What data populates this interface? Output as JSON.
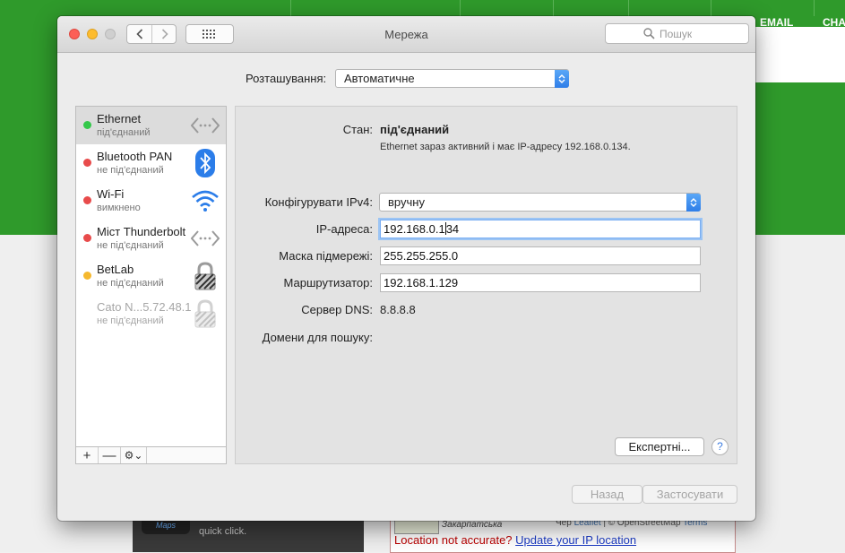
{
  "background": {
    "nav": {
      "email": "EMAIL",
      "chat": "CHA"
    },
    "panel_badge": "Maps",
    "panel_text": "quick click.",
    "map": {
      "region": "Закарпатська",
      "credit_prefix": "Чер",
      "credit_leaflet": "Leaflet",
      "credit_mid": "| © OpenStreetMap",
      "credit_terms": "Terms"
    },
    "location_prompt": "Location not accurate?",
    "location_link": "Update your IP location"
  },
  "window": {
    "title": "Мережа",
    "search_placeholder": "Пошук",
    "location_label": "Розташування:",
    "location_value": "Автоматичне"
  },
  "services": [
    {
      "name": "Ethernet",
      "status": "під'єднаний",
      "dot": "#34c84a",
      "icon": "ethernet-icon",
      "selected": true
    },
    {
      "name": "Bluetooth PAN",
      "status": "не під'єднаний",
      "dot": "#e84b4b",
      "icon": "bluetooth-icon"
    },
    {
      "name": "Wi-Fi",
      "status": "вимкнено",
      "dot": "#e84b4b",
      "icon": "wifi-icon"
    },
    {
      "name": "Міст Thunderbolt",
      "status": "не під'єднаний",
      "dot": "#e84b4b",
      "icon": "thunderbolt-bridge-icon"
    },
    {
      "name": "BetLab",
      "status": "не під'єднаний",
      "dot": "#f5b82e",
      "icon": "vpn-lock-icon"
    },
    {
      "name": "Cato N...5.72.48.1",
      "status": "не під'єднаний",
      "dot": "",
      "icon": "vpn-lock-icon",
      "dimmed": true
    }
  ],
  "sidebar_toolbar": {
    "add": "+",
    "remove": "—",
    "gear": "⚙︎⌄"
  },
  "detail": {
    "status_label": "Стан:",
    "status_value": "під'єднаний",
    "status_note": "Ethernet зараз активний і має IP-адресу 192.168.0.134.",
    "ipv4_label": "Конфігурувати IPv4:",
    "ipv4_value": "вручну",
    "ip_label": "IP-адреса:",
    "ip_value_before_caret": "192.168.0.1",
    "ip_value_after_caret": "34",
    "mask_label": "Маска підмережі:",
    "mask_value": "255.255.255.0",
    "router_label": "Маршрутизатор:",
    "router_value": "192.168.1.129",
    "dns_label": "Сервер DNS:",
    "dns_value": "8.8.8.8",
    "search_domains_label": "Домени для пошуку:",
    "advanced_label": "Експертні...",
    "help_label": "?"
  },
  "footer": {
    "revert_label": "Назад",
    "apply_label": "Застосувати"
  }
}
